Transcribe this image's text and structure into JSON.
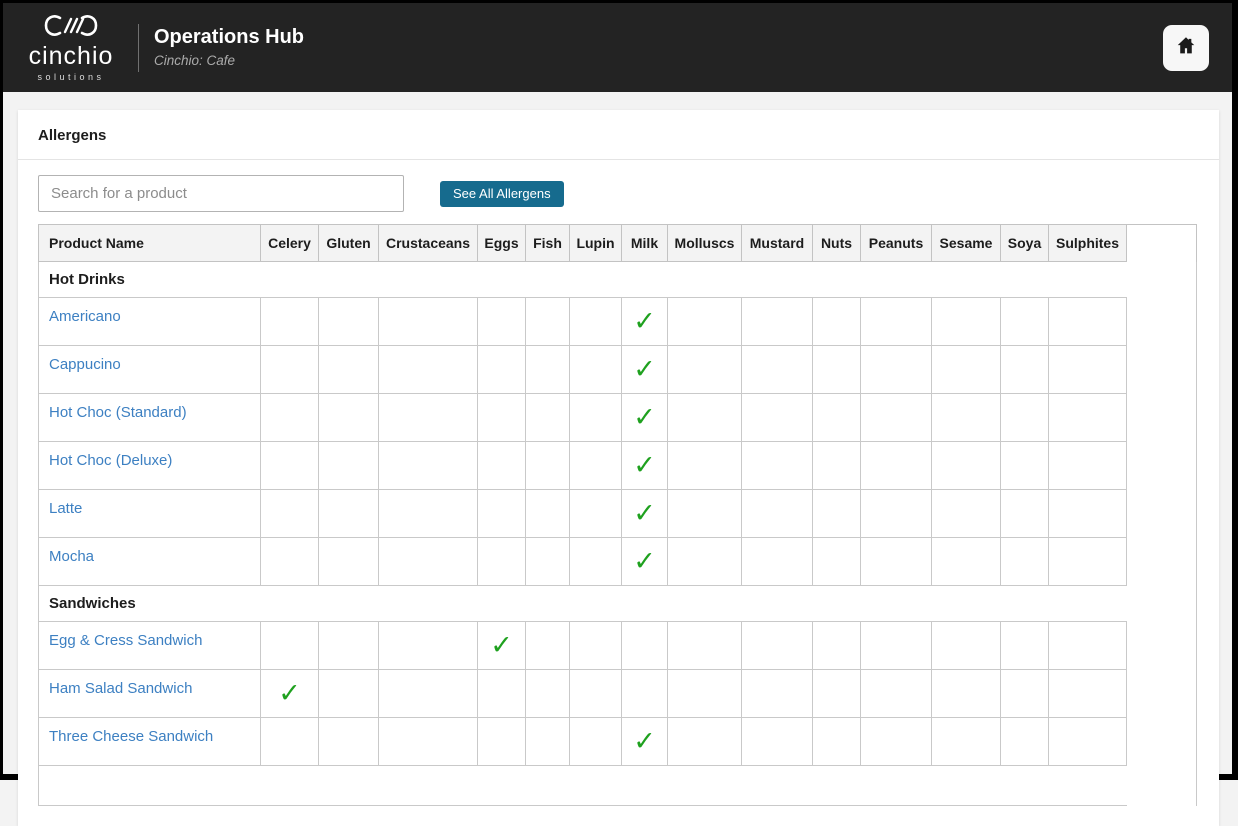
{
  "header": {
    "logo": {
      "brand": "cinchio",
      "sub": "solutions",
      "mark_icon": "cinchio-infinity-mark"
    },
    "title": "Operations Hub",
    "subtitle": "Cinchio: Cafe",
    "home_icon": "home-icon"
  },
  "page": {
    "title": "Allergens"
  },
  "toolbar": {
    "search_placeholder": "Search for a product",
    "search_value": "",
    "see_all_button": "See All Allergens"
  },
  "colors": {
    "header_bg": "#232323",
    "button": "#166b8e",
    "link": "#3d80c2",
    "check": "#1fa11f",
    "table_border": "#c9c9c9"
  },
  "table": {
    "check_glyph": "✓",
    "columns": [
      "Product Name",
      "Celery",
      "Gluten",
      "Crustaceans",
      "Eggs",
      "Fish",
      "Lupin",
      "Milk",
      "Molluscs",
      "Mustard",
      "Nuts",
      "Peanuts",
      "Sesame",
      "Soya",
      "Sulphites"
    ],
    "rows": [
      {
        "type": "category",
        "label": "Hot Drinks"
      },
      {
        "type": "product",
        "name": "Americano",
        "allergens": [
          "Milk"
        ]
      },
      {
        "type": "product",
        "name": "Cappucino",
        "allergens": [
          "Milk"
        ]
      },
      {
        "type": "product",
        "name": "Hot Choc (Standard)",
        "allergens": [
          "Milk"
        ]
      },
      {
        "type": "product",
        "name": "Hot Choc (Deluxe)",
        "allergens": [
          "Milk"
        ]
      },
      {
        "type": "product",
        "name": "Latte",
        "allergens": [
          "Milk"
        ]
      },
      {
        "type": "product",
        "name": "Mocha",
        "allergens": [
          "Milk"
        ]
      },
      {
        "type": "category",
        "label": "Sandwiches"
      },
      {
        "type": "product",
        "name": "Egg & Cress Sandwich",
        "allergens": [
          "Eggs"
        ]
      },
      {
        "type": "product",
        "name": "Ham Salad Sandwich",
        "allergens": [
          "Celery"
        ]
      },
      {
        "type": "product",
        "name": "Three Cheese Sandwich",
        "allergens": [
          "Milk"
        ]
      },
      {
        "type": "partial",
        "label": ""
      }
    ]
  }
}
